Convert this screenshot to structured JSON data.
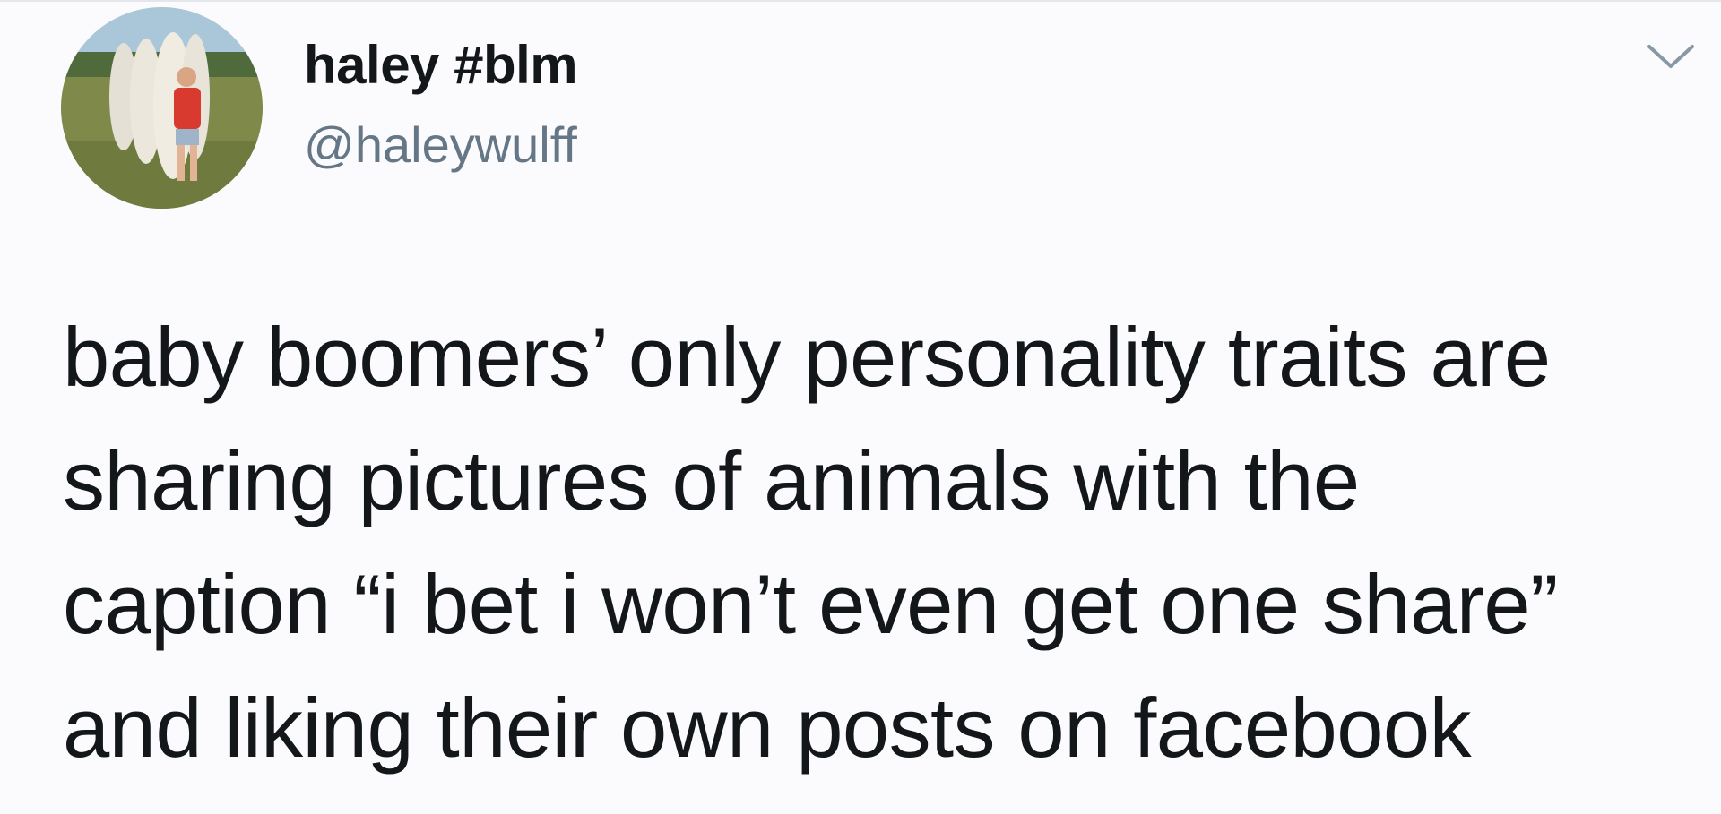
{
  "tweet": {
    "author": {
      "display_name": "haley #blm",
      "handle": "@haleywulff",
      "avatar_icon": "profile-photo"
    },
    "menu_icon": "chevron-down-icon",
    "text_lines": [
      "baby boomers’ only personality traits are",
      "sharing pictures of animals with the",
      "caption “i bet i won’t even get one share”",
      "and liking their own posts on facebook"
    ]
  },
  "colors": {
    "background": "#fbfbfd",
    "text": "#14171a",
    "secondary_text": "#657786",
    "chevron": "#8899a6"
  }
}
